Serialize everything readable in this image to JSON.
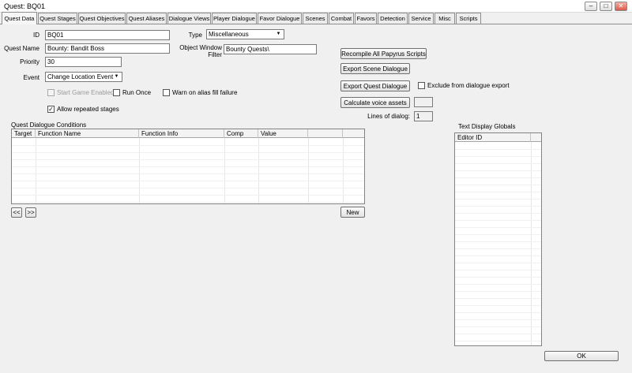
{
  "window": {
    "title": "Quest: BQ01",
    "minimize_glyph": "–",
    "maximize_glyph": "□",
    "close_glyph": "✕"
  },
  "tabs": [
    {
      "label": "Quest Data",
      "active": true
    },
    {
      "label": "Quest Stages"
    },
    {
      "label": "Quest Objectives"
    },
    {
      "label": "Quest Aliases"
    },
    {
      "label": "Dialogue Views"
    },
    {
      "label": "Player Dialogue"
    },
    {
      "label": "Favor Dialogue"
    },
    {
      "label": "Scenes"
    },
    {
      "label": "Combat"
    },
    {
      "label": "Favors"
    },
    {
      "label": "Detection"
    },
    {
      "label": "Service"
    },
    {
      "label": "Misc"
    },
    {
      "label": "Scripts"
    }
  ],
  "form": {
    "id_label": "ID",
    "id_value": "BQ01",
    "quest_name_label": "Quest Name",
    "quest_name_value": "Bounty: Bandit Boss",
    "priority_label": "Priority",
    "priority_value": "30",
    "event_label": "Event",
    "event_value": "Change Location Event",
    "type_label": "Type",
    "type_value": "Miscellaneous",
    "owf_label_1": "Object Window",
    "owf_label_2": "Filter",
    "owf_value": "Bounty Quests\\",
    "start_game_enabled_label": "Start Game Enabled",
    "start_game_enabled_checked": false,
    "run_once_label": "Run Once",
    "run_once_checked": false,
    "warn_alias_label": "Warn on alias fill failure",
    "warn_alias_checked": false,
    "allow_repeated_label": "Allow repeated stages",
    "allow_repeated_checked": true,
    "check_glyph": "✓",
    "dropdown_glyph": "▼"
  },
  "actions": {
    "recompile_label": "Recompile All Papyrus Scripts",
    "export_scene_label": "Export Scene Dialogue",
    "export_quest_label": "Export Quest Dialogue",
    "exclude_label": "Exclude from dialogue export",
    "exclude_checked": false,
    "calc_voice_label": "Calculate voice assets",
    "calc_voice_value": "",
    "lines_label": "Lines of dialog:",
    "lines_value": "1"
  },
  "conditions": {
    "title": "Quest Dialogue Conditions",
    "columns": [
      "Target",
      "Function Name",
      "Function Info",
      "Comp",
      "Value",
      ""
    ],
    "rows": [],
    "prev_label": "<<",
    "next_label": ">>",
    "new_label": "New"
  },
  "globals": {
    "title": "Text Display Globals",
    "columns": [
      "Editor ID",
      ""
    ],
    "rows": []
  },
  "ok_label": "OK"
}
